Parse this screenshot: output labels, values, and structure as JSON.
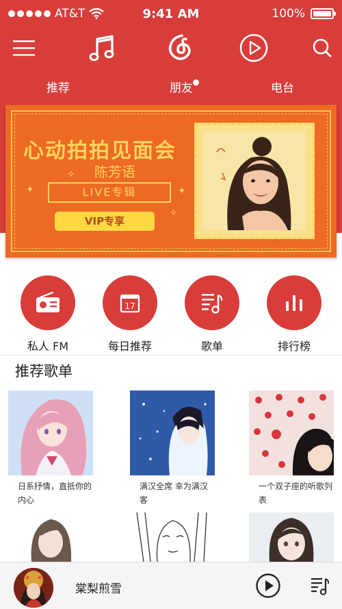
{
  "status_bar": {
    "carrier": "AT&T",
    "time": "9:41 AM",
    "battery": "100%"
  },
  "topbar": {
    "icons": [
      "menu-icon",
      "music-note-icon",
      "netease-logo-icon",
      "play-circle-icon",
      "search-icon"
    ]
  },
  "tabs": [
    {
      "label": "推荐"
    },
    {
      "label": "朋友"
    },
    {
      "label": "电台"
    }
  ],
  "banner": {
    "title": "心动拍拍见面会",
    "artist": "陈芳语",
    "ribbon": "LIVE专辑",
    "vip": "VIP专享"
  },
  "actions": [
    {
      "label": "私人 FM",
      "icon": "radio-icon"
    },
    {
      "label": "每日推荐",
      "icon": "calendar-icon",
      "day": "17"
    },
    {
      "label": "歌单",
      "icon": "playlist-icon"
    },
    {
      "label": "排行榜",
      "icon": "chart-icon"
    }
  ],
  "section": {
    "title": "推荐歌单"
  },
  "playlists": [
    {
      "name": "日系抒情，直抵你的内心"
    },
    {
      "name": "满汉全席  幸为满汉客"
    },
    {
      "name": "一个双子座的听歌列表"
    }
  ],
  "player": {
    "song": "棠梨煎雪"
  },
  "colors": {
    "brand_red": "#d83d3a",
    "banner_orange": "#ec6a24",
    "banner_gold": "#ffd35c"
  }
}
